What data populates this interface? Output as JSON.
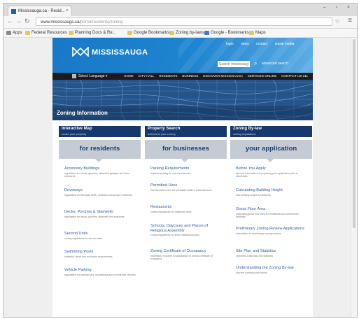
{
  "browser": {
    "tab_title": "Mississauga.ca - Resid...",
    "tab_close": "×",
    "url": "www.mississauga.ca/",
    "url_path": "portal/residents/zoning",
    "window_controls": "– ▫ ×",
    "bookmarks": [
      {
        "label": "Apps",
        "style": "grid"
      },
      {
        "label": "Federal Resources",
        "style": "folder"
      },
      {
        "label": "Planning Docs & Re...",
        "style": "folder"
      },
      {
        "label": "Google Bookmarks",
        "style": "folder"
      },
      {
        "label": "Zoning by-laws",
        "style": "folder"
      },
      {
        "label": "Google - Bookmarks",
        "style": "blue"
      },
      {
        "label": "Maps",
        "style": "folder"
      }
    ]
  },
  "site": {
    "brand": {
      "name": "MISSISSAUGA",
      "logo_color": "#ffffff"
    },
    "header": {
      "top_links": [
        "login",
        "news",
        "contact",
        "social media"
      ],
      "search_placeholder": "Search mississauga.ca",
      "advanced_search": "advanced search"
    },
    "nav": {
      "language": "Select Language ▾",
      "items": [
        "HOME",
        "CITY HALL",
        "RESIDENTS",
        "BUSINESS",
        "DISCOVER MISSISSAUGA",
        "SERVICES ONLINE",
        "CONTACT US 311"
      ]
    },
    "hero_title": "Zoning Information",
    "cards": [
      {
        "title": "Interactive Map",
        "sub": "locate your property"
      },
      {
        "title": "Property Search",
        "sub": "determine your zoning"
      },
      {
        "title": "Zoning By-law",
        "sub": "zoning regulations"
      }
    ],
    "tabs": [
      "for residents",
      "for businesses",
      "your application"
    ],
    "columns": [
      [
        {
          "title": "Accessory Buildings",
          "desc": "regulations for sheds, gazebos, detached garages and other structures"
        },
        {
          "title": "Driveways",
          "desc": "regulations for driveway width, setbacks and surface treatment"
        },
        {
          "title": "Decks, Porches & Stairwells",
          "desc": "regulations for decks, porches, stairwells and balconies"
        },
        {
          "title": "Second Units",
          "desc": "zoning regulations for second units"
        },
        {
          "title": "Swimming Pools",
          "desc": "setbacks, fence and enclosure requirements"
        },
        {
          "title": "Vehicle Parking",
          "desc": "regulations for parking cars, recreational and commercial vehicles"
        }
      ],
      [
        {
          "title": "Parking Requirements",
          "desc": "required parking for commercial uses"
        },
        {
          "title": "Permitted Uses",
          "desc": "find out which uses are permitted within a particular zone"
        },
        {
          "title": "Restaurants",
          "desc": "zoning regulations for restaurant uses"
        },
        {
          "title": "Schools, Daycares and Places of Religious Assembly",
          "desc": "zoning regulations for these institutional uses"
        },
        {
          "title": "Zoning Certificate of Occupancy",
          "desc": "information required for application of zoning certificate of occupancy"
        }
      ],
      [
        {
          "title": "Before You Apply",
          "desc": "tips and information on preparing your application prior to submission"
        },
        {
          "title": "Calculating Building Height",
          "desc": "how building height is measured"
        },
        {
          "title": "Gross Floor Area",
          "desc": "calculating gross floor area for residential and commercial buildings"
        },
        {
          "title": "Preliminary Zoning Review Applications",
          "desc": "information on preliminary zoning reviews"
        },
        {
          "title": "Site Plan and Statistics",
          "desc": "preparing a site plan and statistics"
        },
        {
          "title": "Understanding the Zoning By-law",
          "desc": "how the zoning by-law works"
        }
      ]
    ]
  }
}
